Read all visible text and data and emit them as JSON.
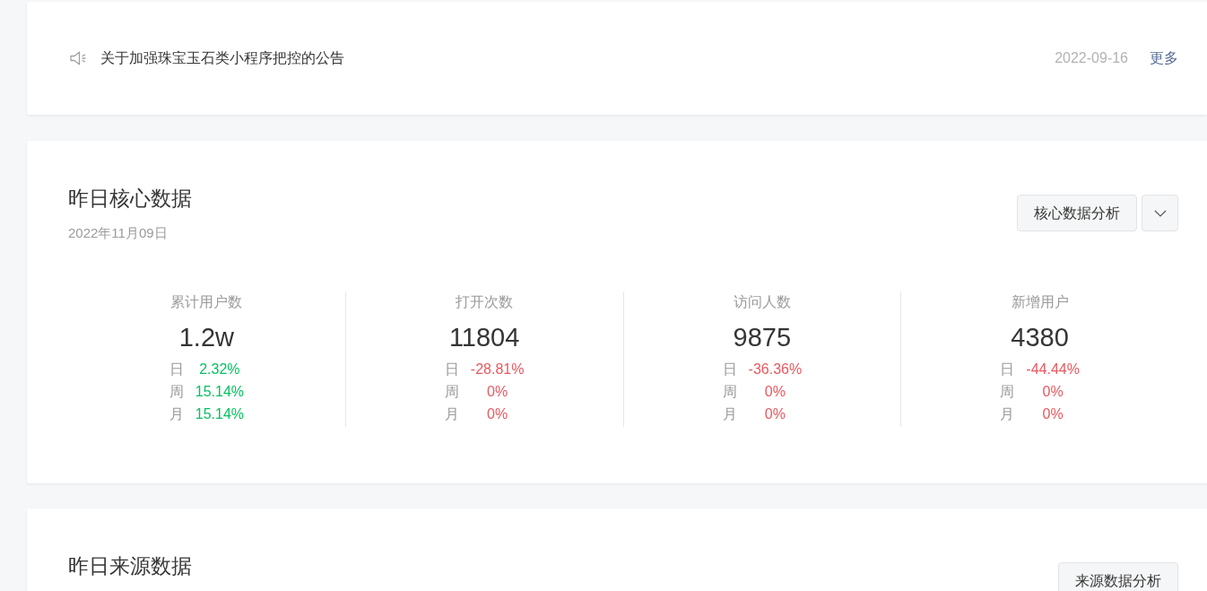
{
  "notice": {
    "text": "关于加强珠宝玉石类小程序把控的公告",
    "date": "2022-09-16",
    "more_link": "更多"
  },
  "core_data": {
    "title": "昨日核心数据",
    "date": "2022年11月09日",
    "button": "核心数据分析",
    "metrics": [
      {
        "label": "累计用户数",
        "value": "1.2w",
        "changes": [
          {
            "period": "日",
            "value": "2.32%",
            "color": "#07c160"
          },
          {
            "period": "周",
            "value": "15.14%",
            "color": "#07c160"
          },
          {
            "period": "月",
            "value": "15.14%",
            "color": "#07c160"
          }
        ]
      },
      {
        "label": "打开次数",
        "value": "11804",
        "changes": [
          {
            "period": "日",
            "value": "-28.81%",
            "color": "#e8585f"
          },
          {
            "period": "周",
            "value": "0%",
            "color": "#e8585f"
          },
          {
            "period": "月",
            "value": "0%",
            "color": "#e8585f"
          }
        ]
      },
      {
        "label": "访问人数",
        "value": "9875",
        "changes": [
          {
            "period": "日",
            "value": "-36.36%",
            "color": "#e8585f"
          },
          {
            "period": "周",
            "value": "0%",
            "color": "#e8585f"
          },
          {
            "period": "月",
            "value": "0%",
            "color": "#e8585f"
          }
        ]
      },
      {
        "label": "新增用户",
        "value": "4380",
        "changes": [
          {
            "period": "日",
            "value": "-44.44%",
            "color": "#e8585f"
          },
          {
            "period": "周",
            "value": "0%",
            "color": "#e8585f"
          },
          {
            "period": "月",
            "value": "0%",
            "color": "#e8585f"
          }
        ]
      }
    ]
  },
  "source_data": {
    "title": "昨日来源数据",
    "button": "来源数据分析"
  }
}
